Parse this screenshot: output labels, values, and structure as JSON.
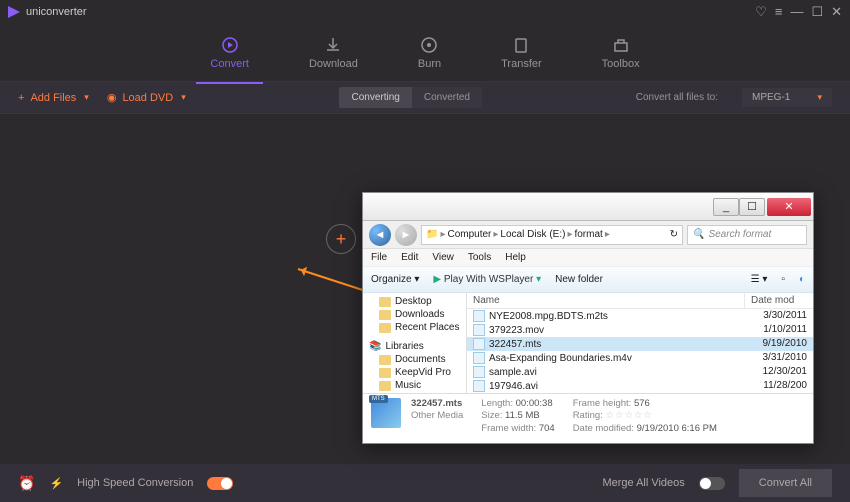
{
  "app": {
    "title": "uniconverter"
  },
  "nav": {
    "items": [
      {
        "label": "Convert"
      },
      {
        "label": "Download"
      },
      {
        "label": "Burn"
      },
      {
        "label": "Transfer"
      },
      {
        "label": "Toolbox"
      }
    ]
  },
  "toolbar": {
    "add_files": "Add Files",
    "load_dvd": "Load DVD",
    "seg_converting": "Converting",
    "seg_converted": "Converted",
    "convert_all_label": "Convert all files to:",
    "convert_all_value": "MPEG-1"
  },
  "footer": {
    "hsc": "High Speed Conversion",
    "merge": "Merge All Videos",
    "convert_all": "Convert All"
  },
  "dialog": {
    "breadcrumb": [
      "Computer",
      "Local Disk (E:)",
      "format"
    ],
    "search_placeholder": "Search format",
    "menu": [
      "File",
      "Edit",
      "View",
      "Tools",
      "Help"
    ],
    "cmdbar": {
      "organize": "Organize",
      "play": "Play With WSPlayer",
      "newfolder": "New folder"
    },
    "tree": {
      "fav": [
        "Desktop",
        "Downloads",
        "Recent Places"
      ],
      "lib_label": "Libraries",
      "lib": [
        "Documents",
        "KeepVid Pro",
        "Music"
      ]
    },
    "list": {
      "hdr_name": "Name",
      "hdr_date": "Date mod",
      "rows": [
        {
          "name": "NYE2008.mpg.BDTS.m2ts",
          "date": "3/30/2011"
        },
        {
          "name": "379223.mov",
          "date": "1/10/2011"
        },
        {
          "name": "322457.mts",
          "date": "9/19/2010"
        },
        {
          "name": "Asa-Expanding Boundaries.m4v",
          "date": "3/31/2010"
        },
        {
          "name": "sample.avi",
          "date": "12/30/201"
        },
        {
          "name": "197946.avi",
          "date": "11/28/200"
        }
      ]
    },
    "detail": {
      "filename": "322457.mts",
      "type": "Other Media",
      "length_k": "Length:",
      "length_v": "00:00:38",
      "size_k": "Size:",
      "size_v": "11.5 MB",
      "fw_k": "Frame width:",
      "fw_v": "704",
      "fh_k": "Frame height:",
      "fh_v": "576",
      "rating_k": "Rating:",
      "dm_k": "Date modified:",
      "dm_v": "9/19/2010 6:16 PM"
    }
  }
}
